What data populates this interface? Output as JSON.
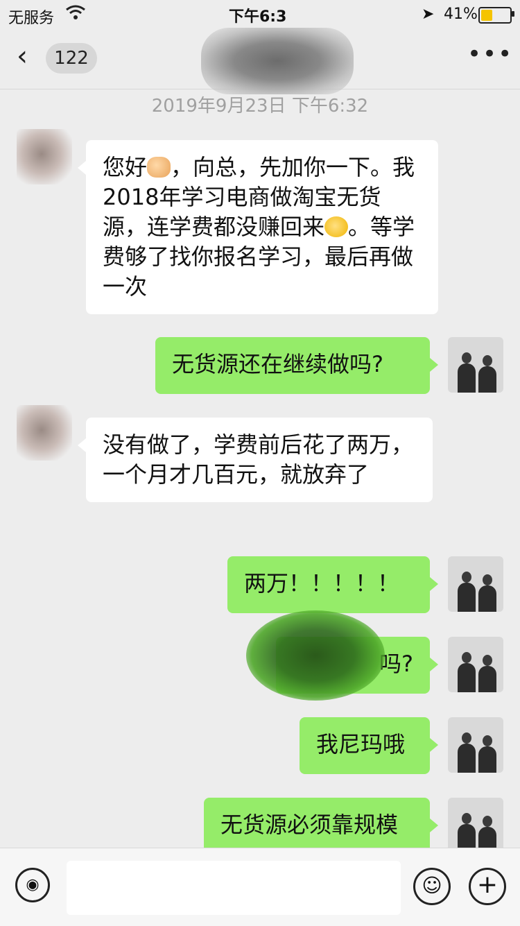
{
  "status_bar": {
    "carrier": "无服务",
    "time": "下午6:3",
    "battery": "41%",
    "battery_level": 0.41
  },
  "nav": {
    "back_icon": "chevron-left-icon",
    "unread_count": "122",
    "more_icon": "more-dots-icon"
  },
  "timestamp": "2019年9月23日 下午6:32",
  "messages": [
    {
      "side": "in",
      "parts": [
        "您好",
        "，向总，先加你一下。我2018年学习电商做淘宝无货源，连学费都没赚回来",
        "。等学费够了找你报名学习，最后再做一次"
      ]
    },
    {
      "side": "out",
      "text": "无货源还在继续做吗?"
    },
    {
      "side": "in",
      "text": "没有做了，学费前后花了两万，一个月才几百元，就放弃了"
    },
    {
      "side": "out",
      "text": "两万！！！！！"
    },
    {
      "side": "out",
      "text": "吗?"
    },
    {
      "side": "out",
      "text": "我尼玛哦"
    },
    {
      "side": "out",
      "text": "无货源必须靠规模"
    }
  ],
  "input_bar": {
    "voice_icon": "voice-icon",
    "emoji_icon": "emoji-icon",
    "plus_icon": "plus-icon",
    "placeholder": ""
  }
}
